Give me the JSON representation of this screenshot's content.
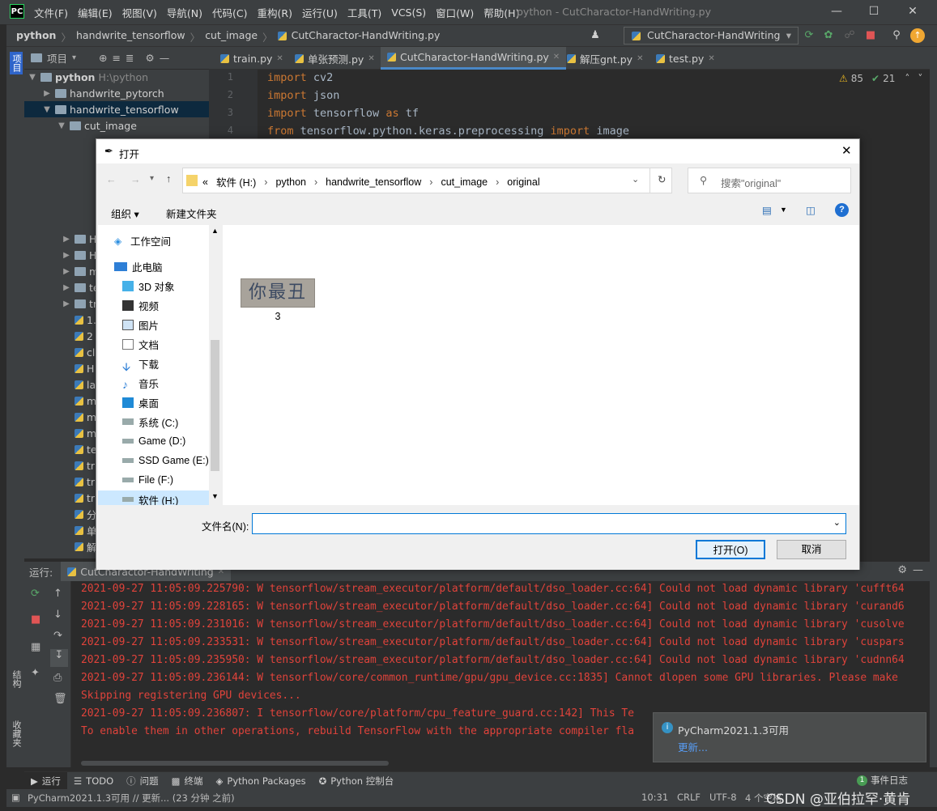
{
  "app": {
    "logo": "PC",
    "window_title": "python - CutCharactor-HandWriting.py",
    "menu": [
      "文件(F)",
      "编辑(E)",
      "视图(V)",
      "导航(N)",
      "代码(C)",
      "重构(R)",
      "运行(U)",
      "工具(T)",
      "VCS(S)",
      "窗口(W)",
      "帮助(H)"
    ]
  },
  "breadcrumb": [
    "python",
    "handwrite_tensorflow",
    "cut_image",
    "CutCharactor-HandWriting.py"
  ],
  "run_config": "CutCharactor-HandWriting",
  "left_strip": {
    "project": "项目",
    "structure": "结构",
    "favorites": "收藏夹"
  },
  "project_panel": {
    "title": "项目",
    "root": {
      "name": "python",
      "path": "H:\\python"
    },
    "items": [
      "handwrite_pytorch",
      "handwrite_tensorflow",
      "cut_image"
    ],
    "partial": [
      "H",
      "H",
      "m",
      "te",
      "tr",
      "1.",
      "2",
      "cl",
      "H",
      "la",
      "m",
      "m",
      "m",
      "te",
      "tr",
      "tr",
      "tr",
      "分",
      "单",
      "解"
    ]
  },
  "tabs": [
    "train.py",
    "单张预测.py",
    "CutCharactor-HandWriting.py",
    "解压gnt.py",
    "test.py"
  ],
  "inspections": {
    "warnings": "85",
    "ok": "21"
  },
  "code": [
    {
      "ln": "1",
      "kw": "import",
      "rest": " cv2"
    },
    {
      "ln": "2",
      "kw": "import",
      "rest": " json"
    },
    {
      "ln": "3",
      "kw": "import",
      "rest": " tensorflow ",
      "kw2": "as",
      "rest2": " tf"
    },
    {
      "ln": "4",
      "kw": "from",
      "rest": " tensorflow.python.keras.preprocessing ",
      "kw2": "import",
      "rest2": " image"
    }
  ],
  "dialog": {
    "title": "打开",
    "address": [
      "«",
      "软件 (H:)",
      "python",
      "handwrite_tensorflow",
      "cut_image",
      "original"
    ],
    "search_placeholder": "搜索\"original\"",
    "organize": "组织 ▾",
    "new_folder": "新建文件夹",
    "nav": [
      "工作空间",
      "此电脑",
      "3D 对象",
      "视频",
      "图片",
      "文档",
      "下载",
      "音乐",
      "桌面",
      "系统 (C:)",
      "Game (D:)",
      "SSD Game (E:)",
      "File (F:)",
      "软件 (H:)"
    ],
    "file": {
      "name": "3",
      "thumb_text": "你最丑"
    },
    "filename_label": "文件名(N):",
    "filename_value": "",
    "open_button": "打开(O)",
    "cancel_button": "取消"
  },
  "run": {
    "label": "运行:",
    "config": "CutCharactor-HandWriting"
  },
  "console": [
    "2021-09-27 11:05:09.225790: W tensorflow/stream_executor/platform/default/dso_loader.cc:64] Could not load dynamic library 'cufft64",
    "2021-09-27 11:05:09.228165: W tensorflow/stream_executor/platform/default/dso_loader.cc:64] Could not load dynamic library 'curand6",
    "2021-09-27 11:05:09.231016: W tensorflow/stream_executor/platform/default/dso_loader.cc:64] Could not load dynamic library 'cusolve",
    "2021-09-27 11:05:09.233531: W tensorflow/stream_executor/platform/default/dso_loader.cc:64] Could not load dynamic library 'cuspars",
    "2021-09-27 11:05:09.235950: W tensorflow/stream_executor/platform/default/dso_loader.cc:64] Could not load dynamic library 'cudnn64",
    "2021-09-27 11:05:09.236144: W tensorflow/core/common_runtime/gpu/gpu_device.cc:1835] Cannot dlopen some GPU libraries. Please make",
    "Skipping registering GPU devices...",
    "2021-09-27 11:05:09.236807: I tensorflow/core/platform/cpu_feature_guard.cc:142] This Te",
    "To enable them in other operations, rebuild TensorFlow with the appropriate compiler fla"
  ],
  "notification": {
    "title": "PyCharm2021.1.3可用",
    "link": "更新..."
  },
  "bottom_tabs": [
    "运行",
    "TODO",
    "问题",
    "终端",
    "Python Packages",
    "Python 控制台"
  ],
  "event_log": {
    "count": "1",
    "label": "事件日志"
  },
  "status": {
    "message": "PyCharm2021.1.3可用 // 更新... (23 分钟 之前)",
    "position": "10:31",
    "line_sep": "CRLF",
    "encoding": "UTF-8",
    "indent": "4 个空格",
    "watermark": "CSDN @亚伯拉罕·黄肯"
  }
}
